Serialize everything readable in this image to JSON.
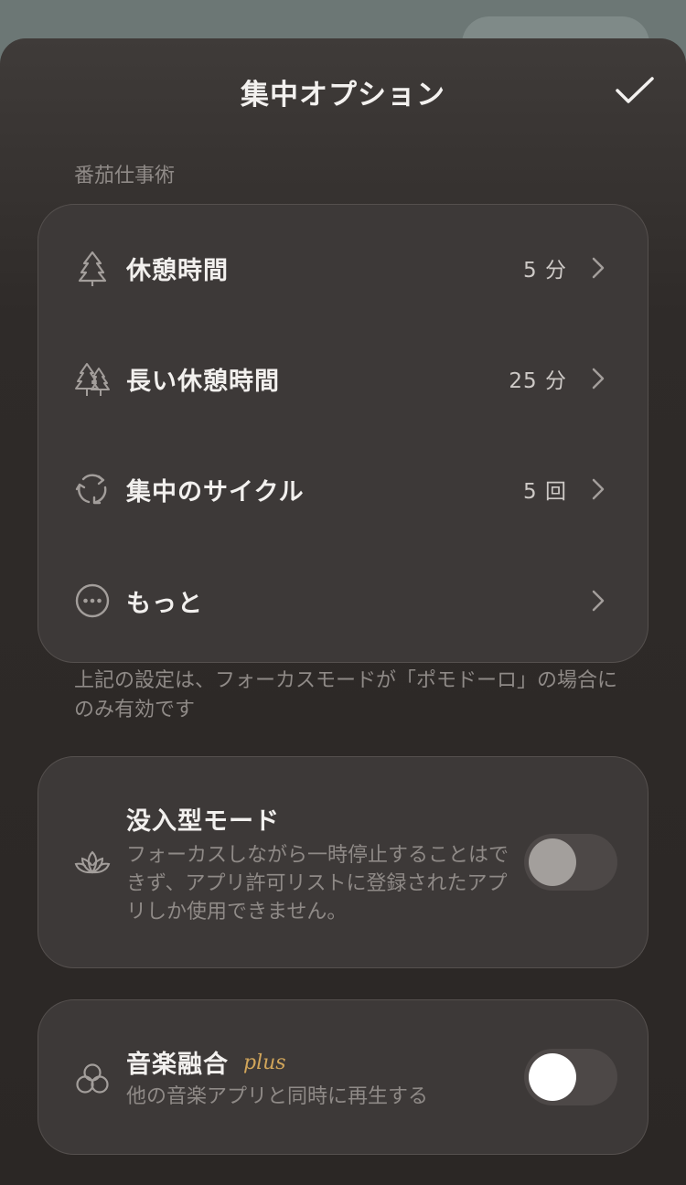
{
  "header": {
    "title": "集中オプション"
  },
  "pomodoro": {
    "section_label": "番茄仕事術",
    "rows": [
      {
        "label": "休憩時間",
        "value": "5 分",
        "icon": "tree-icon"
      },
      {
        "label": "長い休憩時間",
        "value": "25 分",
        "icon": "trees-icon"
      },
      {
        "label": "集中のサイクル",
        "value": "5 回",
        "icon": "cycle-icon"
      },
      {
        "label": "もっと",
        "value": "",
        "icon": "more-icon"
      }
    ],
    "note": "上記の設定は、フォーカスモードが「ポモドーロ」の場合にのみ有効です"
  },
  "immersive": {
    "title": "没入型モード",
    "description": "フォーカスしながら一時停止することはできず、アプリ許可リストに登録されたアプリしか使用できません。",
    "enabled": false,
    "icon": "lotus-icon"
  },
  "music": {
    "title": "音楽融合",
    "badge": "plus",
    "description": "他の音楽アプリと同時に再生する",
    "enabled": false,
    "icon": "circles-icon"
  },
  "colors": {
    "background": "#2e2a28",
    "card": "#3d3938",
    "accent_plus": "#d1a55a",
    "text_primary": "#f2f0ee",
    "text_secondary": "#8f8a87"
  }
}
